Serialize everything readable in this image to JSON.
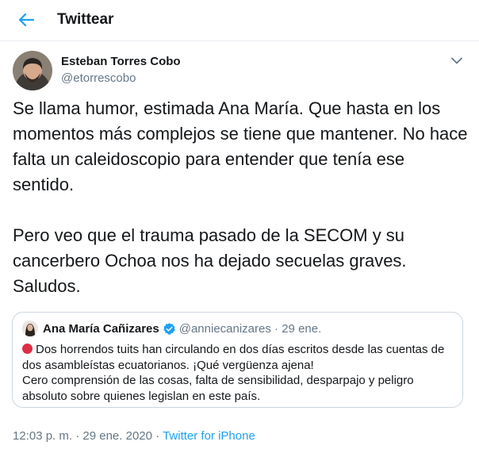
{
  "header": {
    "title": "Twittear",
    "back_icon": "arrow-left-icon",
    "accent_color": "#1da1f2"
  },
  "tweet": {
    "author": {
      "name": "Esteban Torres Cobo",
      "handle": "@etorrescobo"
    },
    "more_icon": "chevron-down-icon",
    "paragraphs": [
      "Se llama humor, estimada Ana María. Que hasta en los momentos más complejos se tiene que mantener. No hace falta un caleidoscopio para entender que tenía ese sentido.",
      "Pero veo que el trauma pasado de la SECOM y su cancerbero Ochoa nos ha dejado secuelas graves. Saludos."
    ],
    "quoted": {
      "name": "Ana María Cañizares",
      "verified_icon": "verified-badge-icon",
      "handle": "@anniecanizares",
      "separator": "·",
      "date": "29 ene.",
      "lines": [
        "Dos horrendos tuits han circulando  en dos días escritos desde las cuentas de dos asambleístas ecuatorianos. ¡Qué vergüenza ajena!",
        "Cero comprensión de las cosas, falta de sensibilidad, desparpajo y peligro absoluto sobre quienes legislan en este país."
      ],
      "emoji_icon": "red-circle-icon"
    },
    "time": "12:03 p. m.",
    "dot1": "·",
    "date": "29 ene. 2020",
    "dot2": "·",
    "source": "Twitter for iPhone"
  }
}
